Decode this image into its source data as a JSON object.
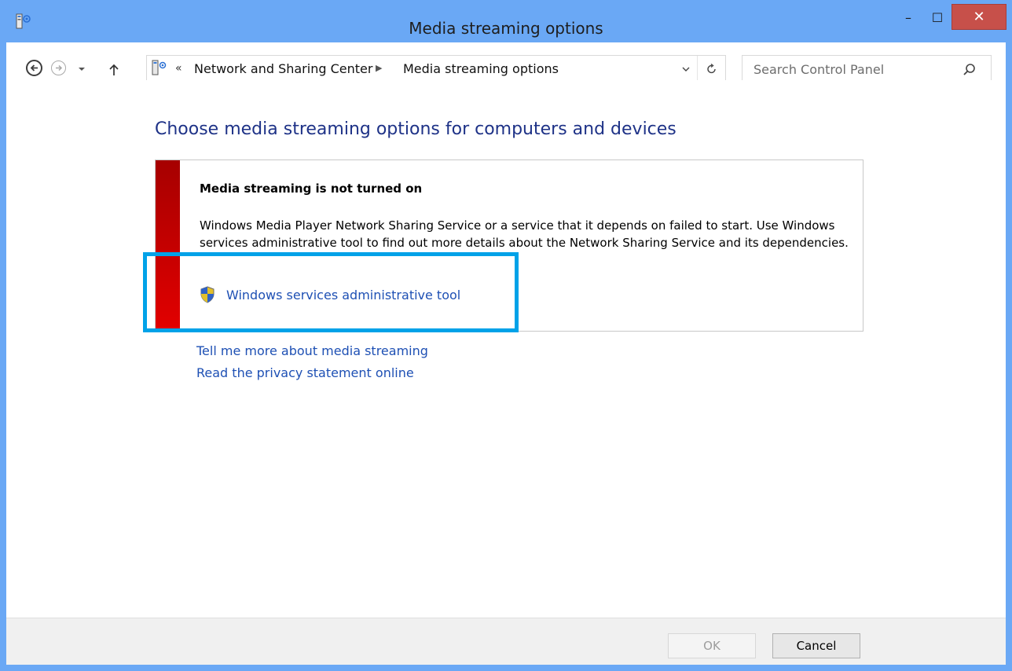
{
  "window": {
    "title": "Media streaming options",
    "close_glyph": "✕",
    "minimize_glyph": "–",
    "maximize_glyph": "☐"
  },
  "address_bar": {
    "overflow": "«",
    "breadcrumbs": [
      "Network and Sharing Center",
      "Media streaming options"
    ],
    "separator": "▶"
  },
  "search": {
    "placeholder": "Search Control Panel"
  },
  "main": {
    "title": "Choose media streaming options for computers and devices",
    "notice": {
      "heading": "Media streaming is not turned on",
      "body": "Windows Media Player Network Sharing Service or a service that it depends on failed to start.  Use Windows services administrative tool to find out more details about the Network Sharing Service and its dependencies.",
      "link": "Windows services administrative tool"
    },
    "links": [
      "Tell me more about media streaming",
      "Read the privacy statement online"
    ]
  },
  "buttons": {
    "ok": "OK",
    "cancel": "Cancel"
  },
  "colors": {
    "title_bar": "#6aa8f5",
    "close_button": "#c7504a",
    "link": "#1e50b4",
    "heading": "#1e3287",
    "error_stripe": "#d80000",
    "highlight": "#00a2e8"
  },
  "icons": [
    "media-server-icon",
    "back-icon",
    "forward-icon",
    "chevron-down-icon",
    "up-arrow-icon",
    "refresh-icon",
    "search-icon",
    "uac-shield-icon"
  ]
}
